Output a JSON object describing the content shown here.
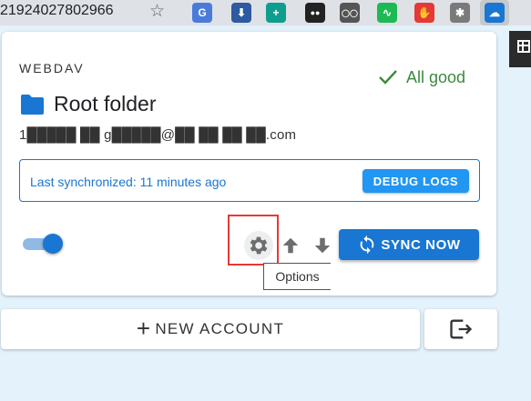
{
  "browser": {
    "url_fragment": "21924027802966",
    "extensions": [
      {
        "name": "translate",
        "letter": "G",
        "color": "#4a7bdb"
      },
      {
        "name": "download",
        "letter": "⬇",
        "color": "#2d5aa0"
      },
      {
        "name": "plus-square",
        "letter": "+",
        "color": "#0f9d8f"
      },
      {
        "name": "eyes",
        "letter": "●●",
        "color": "#222222"
      },
      {
        "name": "mask",
        "letter": "◯◯",
        "color": "#555555"
      },
      {
        "name": "audio",
        "letter": "∿",
        "color": "#1db954"
      },
      {
        "name": "stop-hand",
        "letter": "✋",
        "color": "#e53935"
      },
      {
        "name": "palm",
        "letter": "✱",
        "color": "#7a7a7a"
      },
      {
        "name": "cloud-sync",
        "letter": "☁",
        "color": "#1976d2"
      }
    ]
  },
  "account": {
    "provider": "WEBDAV",
    "status": "All good",
    "folder_name": "Root folder",
    "email": "1█████ ██ g█████@██ ██ ██ ██.com",
    "last_sync": "Last synchronized: 11 minutes ago",
    "debug_label": "DEBUG LOGS",
    "sync_label": "SYNC NOW",
    "toggle_on": true,
    "tooltip": "Options"
  },
  "footer": {
    "new_account_label": "NEW ACCOUNT"
  },
  "colors": {
    "primary": "#1976d2",
    "success": "#3c8a3e",
    "background": "#e3f2fb",
    "highlight": "#e53935"
  }
}
